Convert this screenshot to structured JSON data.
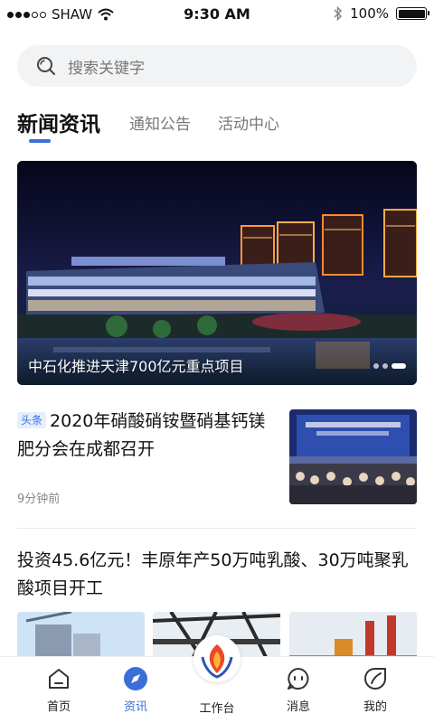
{
  "status_bar": {
    "carrier": "SHAW",
    "time": "9:30 AM",
    "battery": "100%",
    "battery_level": 1.0
  },
  "search": {
    "placeholder": "搜索关键字"
  },
  "tabs": [
    {
      "label": "新闻资讯",
      "active": true
    },
    {
      "label": "通知公告",
      "active": false
    },
    {
      "label": "活动中心",
      "active": false
    }
  ],
  "banner": {
    "caption": "中石化推进天津700亿元重点项目",
    "slide_count": 3,
    "active_slide": 3
  },
  "news": [
    {
      "tag": "头条",
      "title": "2020年硝酸硝铵暨硝基钙镁肥分会在成都召开",
      "time": "9分钟前"
    },
    {
      "title": "投资45.6亿元！丰原年产50万吨乳酸、30万吨聚乳酸项目开工"
    }
  ],
  "bottom_nav": [
    {
      "label": "首页",
      "icon": "home-icon"
    },
    {
      "label": "资讯",
      "icon": "compass-icon",
      "active": true
    },
    {
      "label": "工作台",
      "icon": "logo-icon"
    },
    {
      "label": "消息",
      "icon": "message-icon"
    },
    {
      "label": "我的",
      "icon": "leaf-icon"
    }
  ],
  "colors": {
    "accent": "#3a6fd8",
    "search_bg": "#f2f3f5"
  }
}
